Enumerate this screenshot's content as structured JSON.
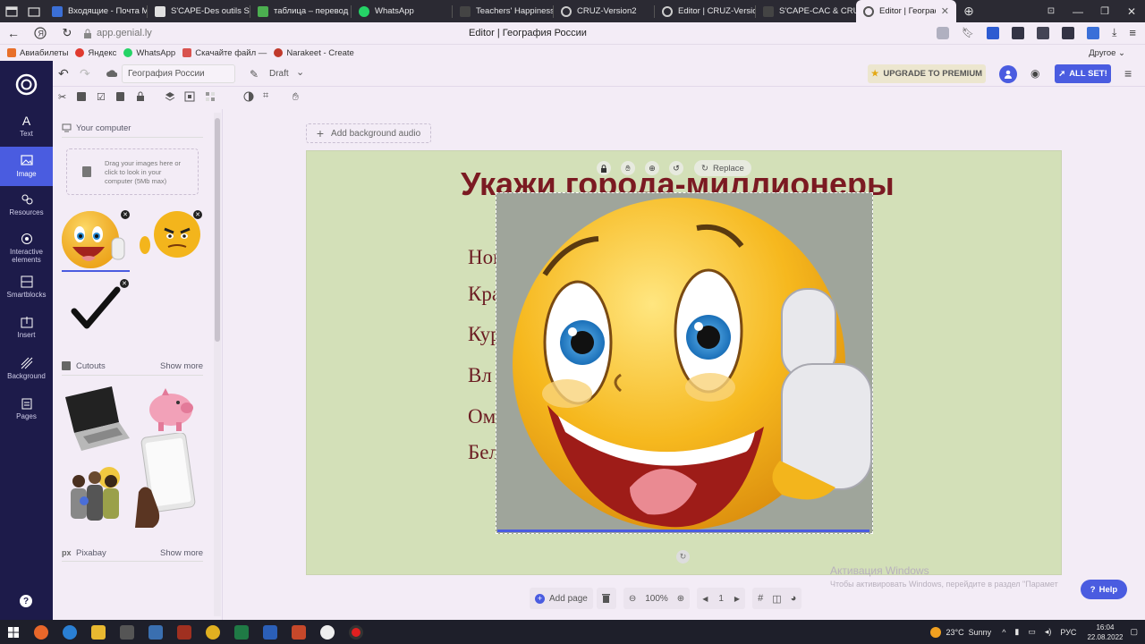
{
  "browser": {
    "tabs": [
      {
        "label": "Входящие - Почта M",
        "color": "#3b6fd6"
      },
      {
        "label": "S'CAPE-Des outils S'C",
        "color": "#e0e0e0"
      },
      {
        "label": "таблица – перевод н",
        "color": "#4caf50"
      },
      {
        "label": "WhatsApp",
        "color": "#25d366"
      },
      {
        "label": "Teachers' Happiness",
        "color": "#e0e0e0"
      },
      {
        "label": "CRUZ-Version2",
        "color": "#cccccc"
      },
      {
        "label": "Editor | CRUZ-Version",
        "color": "#cccccc"
      },
      {
        "label": "S'CAPE-CAC & CRUZ",
        "color": "#e0e0e0"
      },
      {
        "label": "Editor | Географи",
        "color": "#cccccc"
      }
    ],
    "url": "app.genial.ly",
    "page_title": "Editor | География России",
    "bookmarks": [
      {
        "label": "Авиабилеты",
        "color": "#e8702a"
      },
      {
        "label": "Яндекс",
        "color": "#e03a2f"
      },
      {
        "label": "WhatsApp",
        "color": "#25d366"
      },
      {
        "label": "Скачайте файл —",
        "color": "#d9534f"
      },
      {
        "label": "Narakeet - Create",
        "color": "#c0392b"
      }
    ],
    "other_bookmarks": "Другое"
  },
  "editor": {
    "project_name": "География России",
    "status": "Draft",
    "upgrade_label": "UPGRADE TO PREMIUM",
    "allset_label": "ALL SET!",
    "add_audio_label": "Add background audio"
  },
  "sidebar": {
    "items": [
      {
        "label": "Text",
        "icon": "text-icon"
      },
      {
        "label": "Image",
        "icon": "image-icon"
      },
      {
        "label": "Resources",
        "icon": "resources-icon"
      },
      {
        "label": "Interactive elements",
        "icon": "interactive-icon"
      },
      {
        "label": "Smartblocks",
        "icon": "smartblocks-icon"
      },
      {
        "label": "Insert",
        "icon": "insert-icon"
      },
      {
        "label": "Background",
        "icon": "background-icon"
      },
      {
        "label": "Pages",
        "icon": "pages-icon"
      }
    ]
  },
  "panel": {
    "your_computer": "Your computer",
    "upload_hint": "Drag your images here or click to look in your computer (5Mb max)",
    "cutouts": "Cutouts",
    "pixabay": "Pixabay",
    "show_more": "Show more"
  },
  "slide": {
    "title": "Укажи города-миллионеры",
    "lines": [
      "Новоси",
      "Крас",
      "Кур",
      "Вл",
      "Омс",
      "Белго"
    ],
    "replace_label": "Replace",
    "title_color": "#7b1a22",
    "bg_color": "#d3e0b8"
  },
  "bottombar": {
    "add_page": "Add page",
    "zoom": "100%",
    "page": "1"
  },
  "help_label": "Help",
  "watermark": {
    "line1": "Активация Windows",
    "line2": "Чтобы активировать Windows, перейдите в раздел \"Парамет"
  },
  "taskbar": {
    "weather": "23°C  Sunny",
    "lang": "РУС",
    "time": "16:04",
    "date": "22.08.2022"
  }
}
